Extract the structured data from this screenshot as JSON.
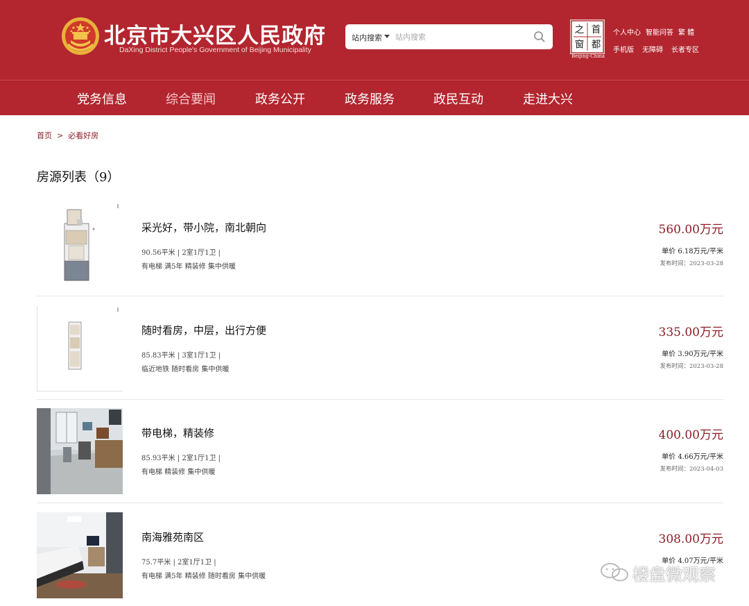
{
  "header": {
    "title": "北京市大兴区人民政府",
    "subtitle": "DaXing District People's Government of Beijing Municipality",
    "search": {
      "scope_label": "站内搜索",
      "placeholder": "站内搜索"
    },
    "capital_logo_caption": "Beijing-China",
    "capital_logo_chars": [
      "首",
      "都",
      "之",
      "窗"
    ],
    "links_row1": [
      "个人中心",
      "智能问答",
      "繁 體"
    ],
    "links_row2": [
      "手机版",
      "无障碍",
      "长者专区"
    ]
  },
  "nav": {
    "items": [
      "党务信息",
      "综合要闻",
      "政务公开",
      "政务服务",
      "政民互动",
      "走进大兴"
    ],
    "active": "综合要闻"
  },
  "breadcrumb": {
    "home": "首页",
    "sep": ">",
    "current": "必看好房"
  },
  "list_title": "房源列表（9）",
  "listings": [
    {
      "name": "采光好，带小院，南北朝向",
      "specs": "90.56平米 | 2室1厅1卫 |",
      "tags": "有电梯 满5年 精装修 集中供暖",
      "price": "560.00万元",
      "unit_price": "单价 6.18万元/平米",
      "date": "发布时间：2023-03-28",
      "thumb": "floorplan"
    },
    {
      "name": "随时看房，中层，出行方便",
      "specs": "85.83平米 | 3室1厅1卫 |",
      "tags": "临近地铁 随时看房 集中供暖",
      "price": "335.00万元",
      "unit_price": "单价 3.90万元/平米",
      "date": "发布时间：2023-03-28",
      "thumb": "floorplan-small"
    },
    {
      "name": "带电梯，精装修",
      "specs": "85.93平米 | 2室1厅1卫 |",
      "tags": "有电梯 精装修 集中供暖",
      "price": "400.00万元",
      "unit_price": "单价 4.66万元/平米",
      "date": "发布时间：2023-04-03",
      "thumb": "room-photo"
    },
    {
      "name": "南海雅苑南区",
      "specs": "75.7平米 | 2室1厅1卫 |",
      "tags": "有电梯 满5年 精装修 随时看房 集中供暖",
      "price": "308.00万元",
      "unit_price": "单价 4.07万元/平米",
      "date": "",
      "thumb": "living-room-photo"
    }
  ],
  "watermark": "楼盘微观察",
  "colors": {
    "brand_red": "#b3262f",
    "price_red": "#8b1c25",
    "active_nav": "#f5c6c9"
  }
}
